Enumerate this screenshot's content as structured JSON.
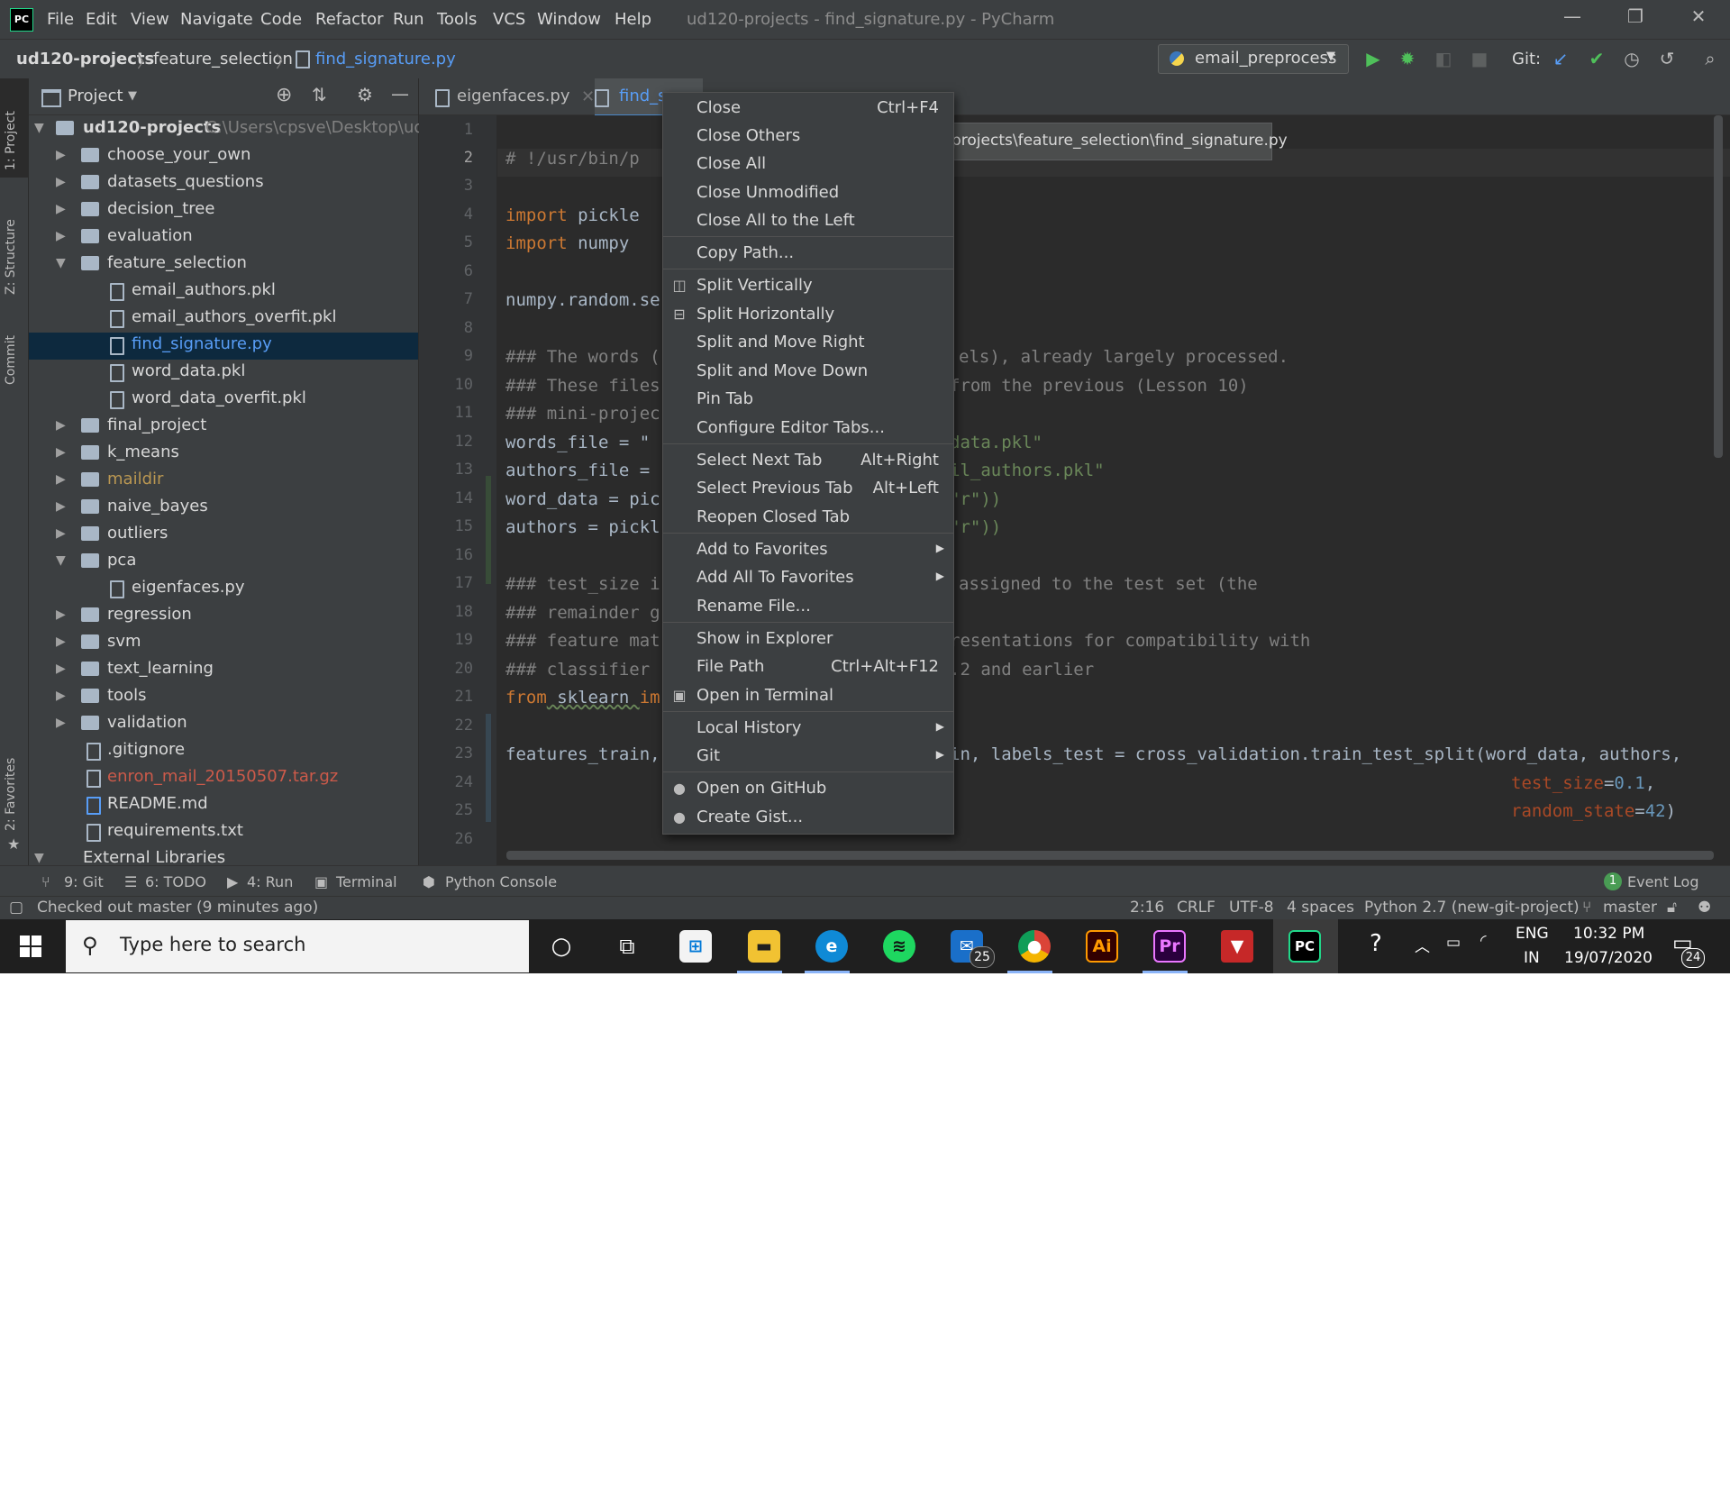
{
  "window": {
    "app_icon": "PC",
    "title": "ud120-projects - find_signature.py - PyCharm",
    "menu": [
      "File",
      "Edit",
      "View",
      "Navigate",
      "Code",
      "Refactor",
      "Run",
      "Tools",
      "VCS",
      "Window",
      "Help"
    ]
  },
  "navbar": {
    "crumbs": [
      "ud120-projects",
      "feature_selection",
      "find_signature.py"
    ],
    "run_config": "email_preprocess",
    "git_label": "Git:"
  },
  "left_stripe": {
    "project": "1: Project",
    "structure": "Z: Structure",
    "commit": "Commit",
    "favorites": "2: Favorites"
  },
  "project_panel": {
    "title": "Project",
    "root": {
      "name": "ud120-projects",
      "path": "C:\\Users\\cpsve\\Desktop\\udac"
    },
    "items": [
      {
        "label": "choose_your_own"
      },
      {
        "label": "datasets_questions"
      },
      {
        "label": "decision_tree"
      },
      {
        "label": "evaluation"
      },
      {
        "label": "feature_selection"
      },
      {
        "label": "email_authors.pkl"
      },
      {
        "label": "email_authors_overfit.pkl"
      },
      {
        "label": "find_signature.py"
      },
      {
        "label": "word_data.pkl"
      },
      {
        "label": "word_data_overfit.pkl"
      },
      {
        "label": "final_project"
      },
      {
        "label": "k_means"
      },
      {
        "label": "maildir"
      },
      {
        "label": "naive_bayes"
      },
      {
        "label": "outliers"
      },
      {
        "label": "pca"
      },
      {
        "label": "eigenfaces.py"
      },
      {
        "label": "regression"
      },
      {
        "label": "svm"
      },
      {
        "label": "text_learning"
      },
      {
        "label": "tools"
      },
      {
        "label": "validation"
      },
      {
        "label": ".gitignore"
      },
      {
        "label": "enron_mail_20150507.tar.gz"
      },
      {
        "label": "README.md"
      },
      {
        "label": "requirements.txt"
      },
      {
        "label": "External Libraries"
      }
    ]
  },
  "editor": {
    "tabs": [
      "eigenfaces.py",
      "find_s"
    ],
    "tooltip": "projects\\feature_selection\\find_signature.py",
    "line_numbers": [
      "1",
      "2",
      "3",
      "4",
      "5",
      "6",
      "7",
      "8",
      "9",
      "10",
      "11",
      "12",
      "13",
      "14",
      "15",
      "16",
      "17",
      "18",
      "19",
      "20",
      "21",
      "22",
      "23",
      "24",
      "25",
      "26"
    ],
    "code": {
      "l2": "# !/usr/bin/p",
      "l4a": "import",
      "l4b": " pickle",
      "l5a": "import",
      "l5b": " numpy",
      "l7": "numpy.random.se",
      "l9a": "### The words (",
      "l9b": "els), already largely processed.",
      "l10a": "### These files",
      "l10b": "from the previous (Lesson 10)",
      "l11": "### mini-projec",
      "l12a": "words_file = \"",
      "l12b": "data.pkl\"",
      "l13a": "authors_file = ",
      "l13b": "il_authors.pkl\"",
      "l14a": "word_data = pic",
      "l14b": "\"r\"))",
      "l15a": "authors = pickl",
      "l15b": "\"r\"))",
      "l17a": "### test_size i",
      "l17b": "assigned to the test set (the",
      "l18": "### remainder g",
      "l19a": "### feature mat",
      "l19b": "resentations for compatibility with",
      "l20a": "### classifier ",
      "l20b": ".2 and earlier",
      "l21a": "from",
      "l21b": " sklearn ",
      "l21c": "im",
      "l23a": "features_train,",
      "l23b": "in, labels_test = cross_validation.train_test_split(word_data, authors,",
      "l24a": "test_size",
      "l24b": "=",
      "l24c": "0.1",
      "l24d": ",",
      "l25a": "random_state",
      "l25b": "=",
      "l25c": "42",
      "l25d": ")"
    }
  },
  "context_menu": {
    "items": [
      {
        "label": "Close",
        "shortcut": "Ctrl+F4"
      },
      {
        "label": "Close Others"
      },
      {
        "label": "Close All"
      },
      {
        "label": "Close Unmodified"
      },
      {
        "label": "Close All to the Left"
      },
      {
        "label": "Copy Path..."
      },
      {
        "label": "Split Vertically"
      },
      {
        "label": "Split Horizontally"
      },
      {
        "label": "Split and Move Right"
      },
      {
        "label": "Split and Move Down"
      },
      {
        "label": "Pin Tab"
      },
      {
        "label": "Configure Editor Tabs..."
      },
      {
        "label": "Select Next Tab",
        "shortcut": "Alt+Right"
      },
      {
        "label": "Select Previous Tab",
        "shortcut": "Alt+Left"
      },
      {
        "label": "Reopen Closed Tab"
      },
      {
        "label": "Add to Favorites"
      },
      {
        "label": "Add All To Favorites"
      },
      {
        "label": "Rename File..."
      },
      {
        "label": "Show in Explorer"
      },
      {
        "label": "File Path",
        "shortcut": "Ctrl+Alt+F12"
      },
      {
        "label": "Open in Terminal"
      },
      {
        "label": "Local History"
      },
      {
        "label": "Git"
      },
      {
        "label": "Open on GitHub"
      },
      {
        "label": "Create Gist..."
      }
    ]
  },
  "tool_windows": {
    "git": "9: Git",
    "todo": "6: TODO",
    "run": "4: Run",
    "terminal": "Terminal",
    "console": "Python Console",
    "event_log": "Event Log",
    "event_count": "1"
  },
  "status": {
    "message": "Checked out master (9 minutes ago)",
    "position": "2:16",
    "line_sep": "CRLF",
    "encoding": "UTF-8",
    "indent": "4 spaces",
    "interpreter": "Python 2.7 (new-git-project)",
    "branch": "master"
  },
  "taskbar": {
    "search_placeholder": "Type here to search",
    "mail_badge": "25",
    "lang1": "ENG",
    "lang2": "IN",
    "time": "10:32 PM",
    "date": "19/07/2020",
    "notif_count": "24",
    "ai_label": "Ai",
    "pr_label": "Pr",
    "pc_label": "PC"
  },
  "colors": {
    "bg": "#2b2b2b",
    "panel": "#3c3f41",
    "selection": "#0d293e",
    "keyword": "#cc7832",
    "comment": "#808080",
    "string": "#6a8759",
    "number": "#6897bb",
    "accent_blue": "#589df6",
    "maildir": "#ba9752",
    "gitignored": "#cc5a4a"
  }
}
